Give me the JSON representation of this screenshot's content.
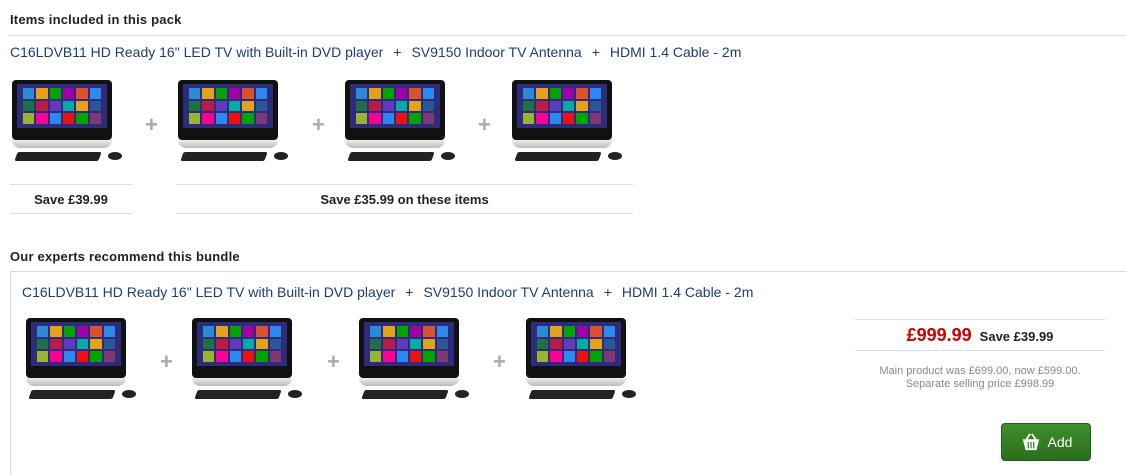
{
  "pack": {
    "title": "Items included in this pack",
    "items": [
      "C16LDVB11 HD Ready 16\" LED TV with Built-in DVD player",
      "SV9150 Indoor TV Antenna",
      "HDMI 1.4 Cable - 2m"
    ],
    "separator": "+",
    "save_main": "Save £39.99",
    "save_others": "Save £35.99 on these items"
  },
  "bundle": {
    "title": "Our experts recommend this bundle",
    "items": [
      "C16LDVB11 HD Ready 16\" LED TV with Built-in DVD player",
      "SV9150 Indoor TV Antenna",
      "HDMI 1.4 Cable - 2m"
    ],
    "separator": "+",
    "price": "£999.99",
    "save": "Save £39.99",
    "note_line1": "Main product was £699.00, now £599.00.",
    "note_line2": "Separate selling price £998.99",
    "add_label": "Add"
  },
  "icons": {
    "product": "all-in-one-pc-icon",
    "plus": "plus-icon",
    "basket": "basket-icon"
  },
  "colors": {
    "link": "#1d3c78",
    "price": "#cc0000",
    "button": "#3e8e2a"
  }
}
